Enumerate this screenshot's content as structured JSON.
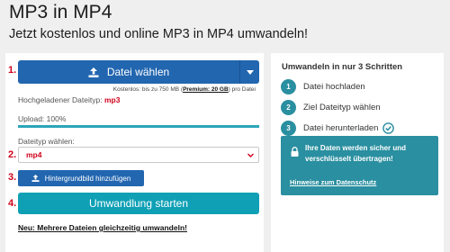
{
  "page": {
    "title": "MP3 in MP4",
    "subtitle": "Jetzt kostenlos und online MP3 in MP4 umwandeln!"
  },
  "converter": {
    "step_markers": [
      "1.",
      "2.",
      "3.",
      "4."
    ],
    "upload_button_label": "Datei wählen",
    "size_note_prefix": "Kostenlos: bis zu 750 MB (",
    "size_note_premium": "Premium: 20 GB",
    "size_note_suffix": ") pro Datei",
    "uploaded_type_label": "Hochgeladener Dateityp:",
    "uploaded_type_value": "mp3",
    "upload_progress_label": "Upload: 100%",
    "upload_progress_fraction": 1.0,
    "filetype_label": "Dateityp wählen:",
    "filetype_selected": "mp4",
    "background_button_label": "Hintergrundbild hinzufügen",
    "convert_button_label": "Umwandlung starten",
    "multi_file_link": "Neu: Mehrere Dateien gleichzeitig umwandeln!"
  },
  "sidebar": {
    "title": "Umwandeln in nur 3 Schritten",
    "steps": [
      {
        "number": "1",
        "label": "Datei hochladen"
      },
      {
        "number": "2",
        "label": "Ziel Dateityp wählen"
      },
      {
        "number": "3",
        "label": "Datei herunterladen"
      }
    ],
    "secure_text": "Ihre Daten werden sicher und verschlüsselt übertragen!",
    "privacy_link": "Hinweise zum Datenschutz"
  },
  "colors": {
    "primary_blue": "#2266b0",
    "teal": "#0fa0b5",
    "accent_red": "#d0021b"
  },
  "icons": {
    "upload": "upload-icon",
    "caret": "caret-down-icon",
    "select_chevron": "chevron-down-icon",
    "check": "check-circle-icon",
    "lock": "lock-icon"
  }
}
